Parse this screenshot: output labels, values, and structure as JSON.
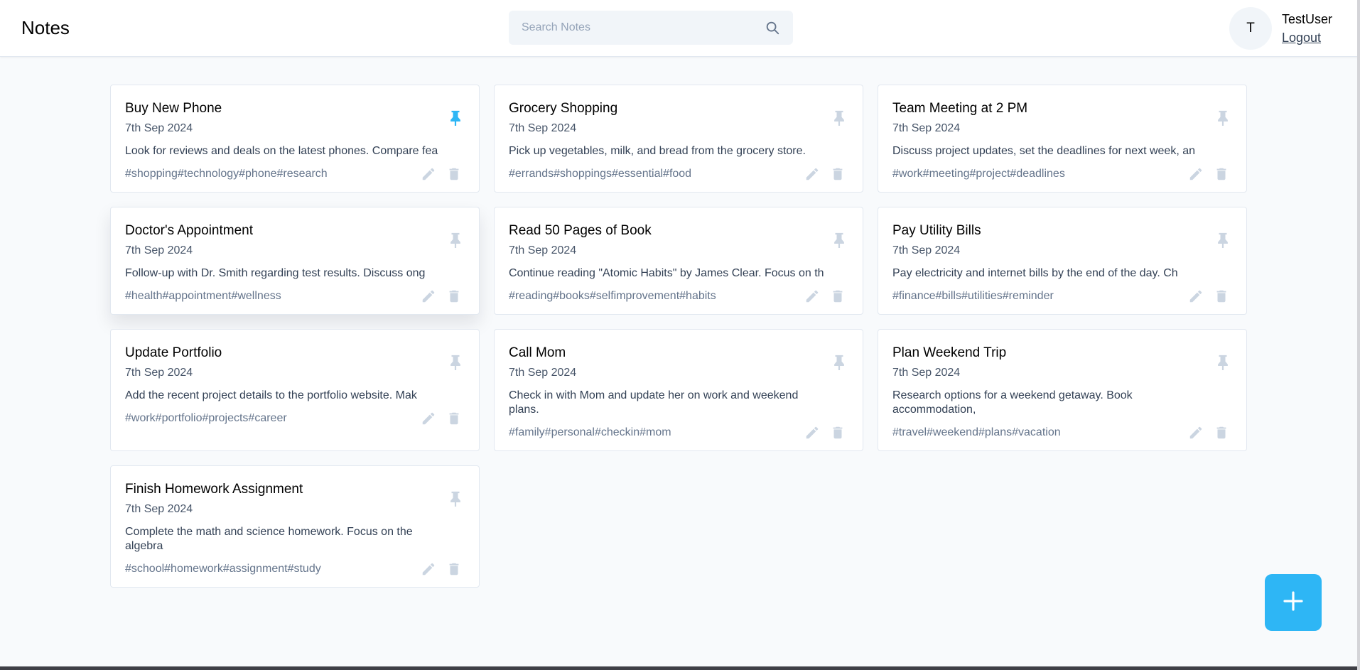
{
  "app": {
    "title": "Notes"
  },
  "search": {
    "placeholder": "Search Notes",
    "value": ""
  },
  "user": {
    "initial": "T",
    "name": "TestUser",
    "logout_label": "Logout"
  },
  "colors": {
    "accent": "#2eb6f5",
    "icon_muted": "#cbd5e1",
    "pinned": "#2eb6f5"
  },
  "notes": [
    {
      "title": "Buy New Phone",
      "date": "7th Sep 2024",
      "content": "Look for reviews and deals on the latest phones. Compare fea",
      "tags": "#shopping#technology#phone#research",
      "pinned": true
    },
    {
      "title": "Grocery Shopping",
      "date": "7th Sep 2024",
      "content": "Pick up vegetables, milk, and bread from the grocery store.",
      "tags": "#errands#shoppings#essential#food",
      "pinned": false
    },
    {
      "title": "Team Meeting at 2 PM",
      "date": "7th Sep 2024",
      "content": "Discuss project updates, set the deadlines for next week, an",
      "tags": "#work#meeting#project#deadlines",
      "pinned": false
    },
    {
      "title": "Doctor's Appointment",
      "date": "7th Sep 2024",
      "content": "Follow-up with Dr. Smith regarding test results. Discuss ong",
      "tags": "#health#appointment#wellness",
      "pinned": false
    },
    {
      "title": "Read 50 Pages of Book",
      "date": "7th Sep 2024",
      "content": "Continue reading \"Atomic Habits\" by James Clear. Focus on th",
      "tags": "#reading#books#selfimprovement#habits",
      "pinned": false
    },
    {
      "title": "Pay Utility Bills",
      "date": "7th Sep 2024",
      "content": "Pay electricity and internet bills by the end of the day. Ch",
      "tags": "#finance#bills#utilities#reminder",
      "pinned": false
    },
    {
      "title": "Update Portfolio",
      "date": "7th Sep 2024",
      "content": "Add the recent project details to the portfolio website. Mak",
      "tags": "#work#portfolio#projects#career",
      "pinned": false
    },
    {
      "title": "Call Mom",
      "date": "7th Sep 2024",
      "content": "Check in with Mom and update her on work and weekend plans.",
      "tags": "#family#personal#checkin#mom",
      "pinned": false
    },
    {
      "title": "Plan Weekend Trip",
      "date": "7th Sep 2024",
      "content": "Research options for a weekend getaway. Book accommodation,",
      "tags": "#travel#weekend#plans#vacation",
      "pinned": false
    },
    {
      "title": "Finish Homework Assignment",
      "date": "7th Sep 2024",
      "content": "Complete the math and science homework. Focus on the algebra",
      "tags": "#school#homework#assignment#study",
      "pinned": false
    }
  ],
  "icons": {
    "search": "search-icon",
    "pin": "pin-icon",
    "edit": "pencil-icon",
    "delete": "trash-icon",
    "add": "plus-icon"
  }
}
